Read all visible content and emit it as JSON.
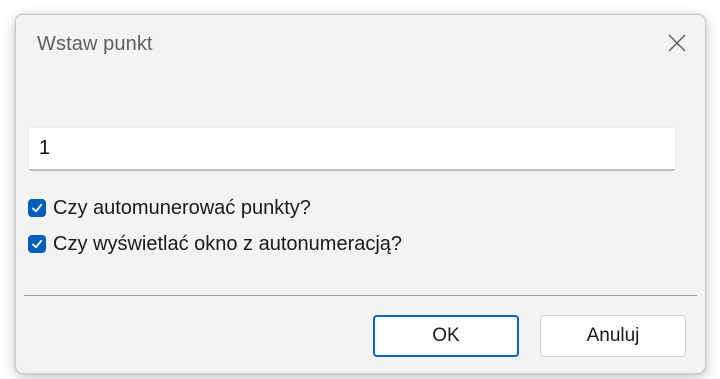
{
  "dialog": {
    "title": "Wstaw punkt",
    "close_icon": "close-icon",
    "input": {
      "value": "1",
      "placeholder": ""
    },
    "checkboxes": [
      {
        "label": "Czy automunerować punkty?",
        "checked": true
      },
      {
        "label": "Czy wyświetlać okno z autonumeracją?",
        "checked": true
      }
    ],
    "buttons": {
      "ok_label": "OK",
      "cancel_label": "Anuluj"
    }
  },
  "colors": {
    "accent": "#005fb8",
    "dialog_background": "#f3f3f3",
    "default_button_border": "#0067c0"
  }
}
